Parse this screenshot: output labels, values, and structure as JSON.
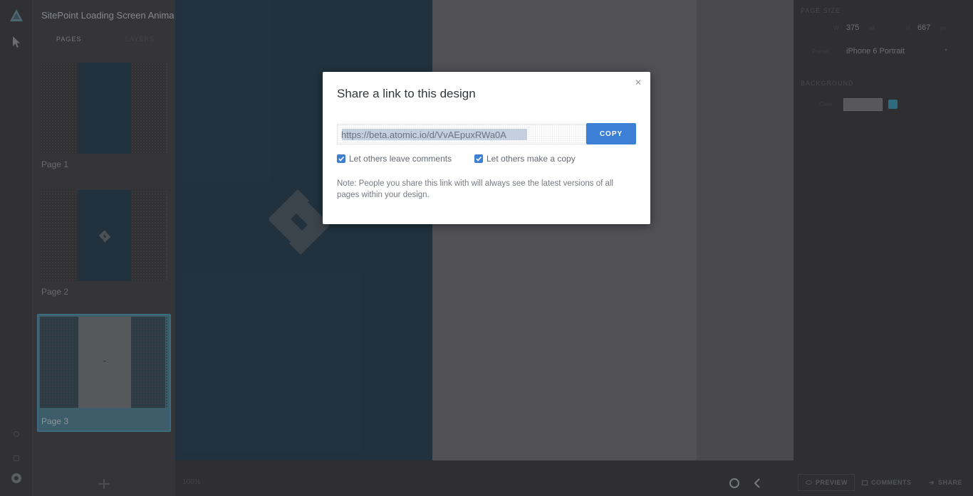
{
  "app": {
    "document_title": "SitePoint Loading Screen Animati"
  },
  "pages_panel": {
    "tabs": [
      {
        "label": "PAGES"
      },
      {
        "label": "LAYERS"
      }
    ],
    "pages": [
      {
        "label": "Page 1"
      },
      {
        "label": "Page 2"
      },
      {
        "label": "Page 3"
      }
    ]
  },
  "canvas": {
    "zoom": "100%"
  },
  "right_panel": {
    "page_size_label": "PAGE SIZE",
    "width_label": "W",
    "width_value": "375",
    "width_unit": "px",
    "height_label": "H",
    "height_value": "667",
    "height_unit": "px",
    "preset_label": "Preset",
    "preset_value": "iPhone 6 Portrait",
    "background_label": "BACKGROUND",
    "color_label": "Color",
    "buttons": {
      "preview": "PREVIEW",
      "comments": "COMMENTS",
      "share": "SHARE"
    }
  },
  "modal": {
    "title": "Share a link to this design",
    "link": "https://beta.atomic.io/d/VvAEpuxRWa0A",
    "copy_label": "COPY",
    "option_comments": "Let others leave comments",
    "option_copy": "Let others make a copy",
    "note": "Note: People you share this link with will always see the latest versions of all pages within your design."
  },
  "colors": {
    "accent": "#3c7fd6",
    "artboard": "#223440",
    "selected_page": "#3f5f6d"
  }
}
